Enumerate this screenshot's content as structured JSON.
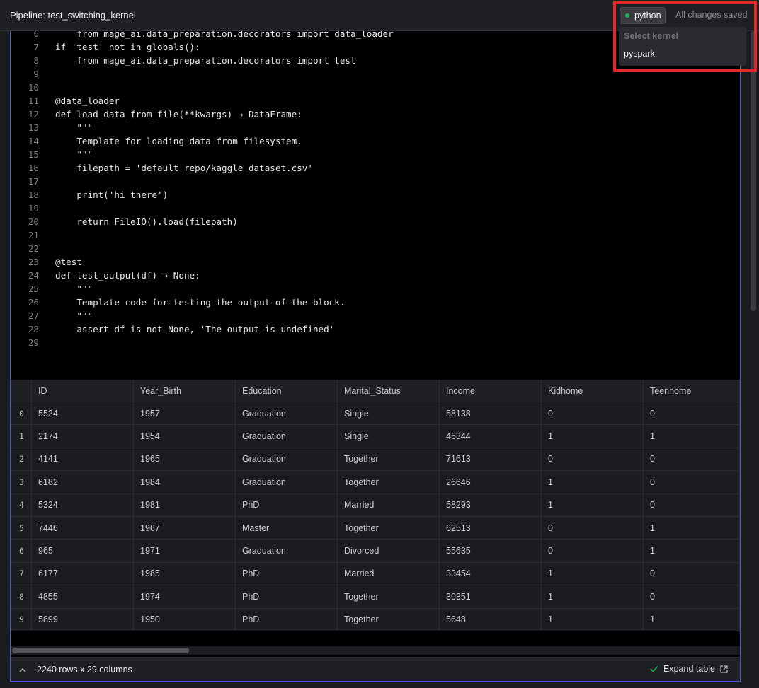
{
  "header": {
    "title": "Pipeline: test_switching_kernel",
    "status": "All changes saved"
  },
  "kernel": {
    "current": "python",
    "status_color": "#1fb25a",
    "menu_header": "Select kernel",
    "options": [
      "pyspark"
    ]
  },
  "code": {
    "lines": [
      {
        "n": "6",
        "t": "    from mage_ai.data_preparation.decorators import data_loader"
      },
      {
        "n": "7",
        "t": "if 'test' not in globals():"
      },
      {
        "n": "8",
        "t": "    from mage_ai.data_preparation.decorators import test"
      },
      {
        "n": "9",
        "t": ""
      },
      {
        "n": "10",
        "t": ""
      },
      {
        "n": "11",
        "t": "@data_loader"
      },
      {
        "n": "12",
        "t": "def load_data_from_file(**kwargs) → DataFrame:"
      },
      {
        "n": "13",
        "t": "    \"\"\""
      },
      {
        "n": "14",
        "t": "    Template for loading data from filesystem."
      },
      {
        "n": "15",
        "t": "    \"\"\""
      },
      {
        "n": "16",
        "t": "    filepath = 'default_repo/kaggle_dataset.csv'"
      },
      {
        "n": "17",
        "t": ""
      },
      {
        "n": "18",
        "t": "    print('hi there')"
      },
      {
        "n": "19",
        "t": ""
      },
      {
        "n": "20",
        "t": "    return FileIO().load(filepath)"
      },
      {
        "n": "21",
        "t": ""
      },
      {
        "n": "22",
        "t": ""
      },
      {
        "n": "23",
        "t": "@test"
      },
      {
        "n": "24",
        "t": "def test_output(df) → None:"
      },
      {
        "n": "25",
        "t": "    \"\"\""
      },
      {
        "n": "26",
        "t": "    Template code for testing the output of the block."
      },
      {
        "n": "27",
        "t": "    \"\"\""
      },
      {
        "n": "28",
        "t": "    assert df is not None, 'The output is undefined'"
      },
      {
        "n": "29",
        "t": ""
      }
    ]
  },
  "table": {
    "columns": [
      "ID",
      "Year_Birth",
      "Education",
      "Marital_Status",
      "Income",
      "Kidhome",
      "Teenhome"
    ],
    "rows": [
      {
        "i": "0",
        "v": [
          "5524",
          "1957",
          "Graduation",
          "Single",
          "58138",
          "0",
          "0"
        ]
      },
      {
        "i": "1",
        "v": [
          "2174",
          "1954",
          "Graduation",
          "Single",
          "46344",
          "1",
          "1"
        ]
      },
      {
        "i": "2",
        "v": [
          "4141",
          "1965",
          "Graduation",
          "Together",
          "71613",
          "0",
          "0"
        ]
      },
      {
        "i": "3",
        "v": [
          "6182",
          "1984",
          "Graduation",
          "Together",
          "26646",
          "1",
          "0"
        ]
      },
      {
        "i": "4",
        "v": [
          "5324",
          "1981",
          "PhD",
          "Married",
          "58293",
          "1",
          "0"
        ]
      },
      {
        "i": "5",
        "v": [
          "7446",
          "1967",
          "Master",
          "Together",
          "62513",
          "0",
          "1"
        ]
      },
      {
        "i": "6",
        "v": [
          "965",
          "1971",
          "Graduation",
          "Divorced",
          "55635",
          "0",
          "1"
        ]
      },
      {
        "i": "7",
        "v": [
          "6177",
          "1985",
          "PhD",
          "Married",
          "33454",
          "1",
          "0"
        ]
      },
      {
        "i": "8",
        "v": [
          "4855",
          "1974",
          "PhD",
          "Together",
          "30351",
          "1",
          "0"
        ]
      },
      {
        "i": "9",
        "v": [
          "5899",
          "1950",
          "PhD",
          "Together",
          "5648",
          "1",
          "1"
        ]
      }
    ]
  },
  "footer": {
    "summary": "2240 rows x 29 columns",
    "expand_label": "Expand table"
  },
  "colors": {
    "highlight": "#e3282a",
    "block_border": "#4a5bd1",
    "success": "#1fb25a"
  }
}
